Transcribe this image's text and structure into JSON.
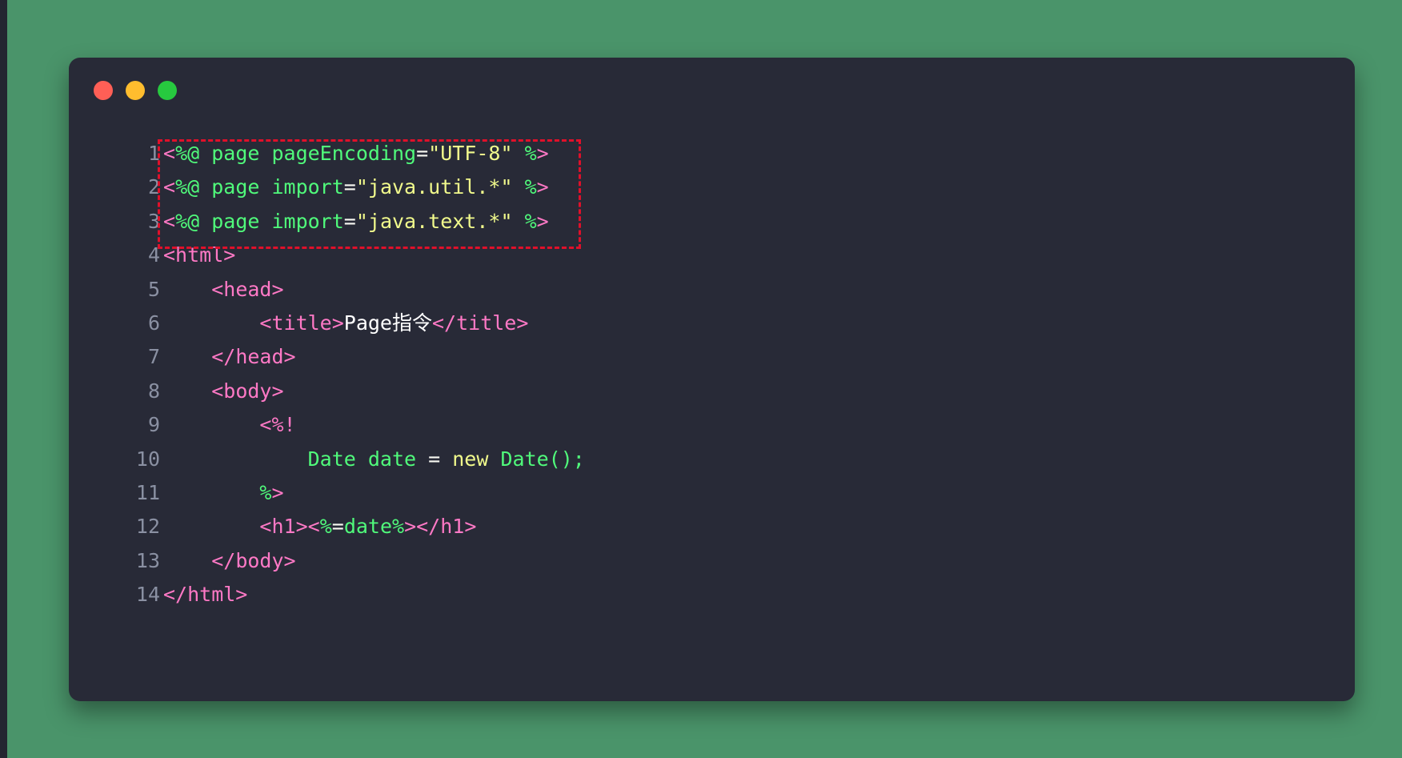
{
  "window": {
    "controls": {
      "close": "close-dot",
      "minimize": "minimize-dot",
      "maximize": "maximize-dot"
    }
  },
  "highlight": {
    "color": "#e0102a",
    "lines": [
      1,
      2,
      3
    ]
  },
  "colors": {
    "background": "#4a946a",
    "editor": "#282a37",
    "tag": "#ff79c6",
    "directive": "#50fa7b",
    "string": "#f1fa8c",
    "plain": "#f8f8f2",
    "line_number": "#8a90a2"
  },
  "code": {
    "lines": [
      {
        "num": "1",
        "tokens": [
          {
            "t": "tag",
            "v": "<"
          },
          {
            "t": "dir",
            "v": "%@ page pageEncoding"
          },
          {
            "t": "pl",
            "v": "="
          },
          {
            "t": "str",
            "v": "\"UTF-8\""
          },
          {
            "t": "pl",
            "v": " "
          },
          {
            "t": "dir",
            "v": "%"
          },
          {
            "t": "tag",
            "v": ">"
          }
        ]
      },
      {
        "num": "2",
        "tokens": [
          {
            "t": "tag",
            "v": "<"
          },
          {
            "t": "dir",
            "v": "%@ page import"
          },
          {
            "t": "pl",
            "v": "="
          },
          {
            "t": "str",
            "v": "\"java.util.*\""
          },
          {
            "t": "pl",
            "v": " "
          },
          {
            "t": "dir",
            "v": "%"
          },
          {
            "t": "tag",
            "v": ">"
          }
        ]
      },
      {
        "num": "3",
        "tokens": [
          {
            "t": "tag",
            "v": "<"
          },
          {
            "t": "dir",
            "v": "%@ page import"
          },
          {
            "t": "pl",
            "v": "="
          },
          {
            "t": "str",
            "v": "\"java.text.*\""
          },
          {
            "t": "pl",
            "v": " "
          },
          {
            "t": "dir",
            "v": "%"
          },
          {
            "t": "tag",
            "v": ">"
          }
        ]
      },
      {
        "num": "4",
        "tokens": [
          {
            "t": "tag",
            "v": "<html>"
          }
        ]
      },
      {
        "num": "5",
        "tokens": [
          {
            "t": "pl",
            "v": "    "
          },
          {
            "t": "tag",
            "v": "<head>"
          }
        ]
      },
      {
        "num": "6",
        "tokens": [
          {
            "t": "pl",
            "v": "        "
          },
          {
            "t": "tag",
            "v": "<title>"
          },
          {
            "t": "txt",
            "v": "Page指令"
          },
          {
            "t": "tag",
            "v": "</title>"
          }
        ]
      },
      {
        "num": "7",
        "tokens": [
          {
            "t": "pl",
            "v": "    "
          },
          {
            "t": "tag",
            "v": "</head>"
          }
        ]
      },
      {
        "num": "8",
        "tokens": [
          {
            "t": "pl",
            "v": "    "
          },
          {
            "t": "tag",
            "v": "<body>"
          }
        ]
      },
      {
        "num": "9",
        "tokens": [
          {
            "t": "pl",
            "v": "        "
          },
          {
            "t": "tag",
            "v": "<%!"
          }
        ]
      },
      {
        "num": "10",
        "tokens": [
          {
            "t": "pl",
            "v": "            "
          },
          {
            "t": "dir",
            "v": "Date date "
          },
          {
            "t": "pl",
            "v": "="
          },
          {
            "t": "str",
            "v": " new "
          },
          {
            "t": "dir",
            "v": "Date();"
          }
        ]
      },
      {
        "num": "11",
        "tokens": [
          {
            "t": "pl",
            "v": "        "
          },
          {
            "t": "dir",
            "v": "%"
          },
          {
            "t": "tag",
            "v": ">"
          }
        ]
      },
      {
        "num": "12",
        "tokens": [
          {
            "t": "pl",
            "v": "        "
          },
          {
            "t": "tag",
            "v": "<h1><"
          },
          {
            "t": "dir",
            "v": "%"
          },
          {
            "t": "pl",
            "v": "="
          },
          {
            "t": "dir",
            "v": "date%"
          },
          {
            "t": "tag",
            "v": "></h1>"
          }
        ]
      },
      {
        "num": "13",
        "tokens": [
          {
            "t": "pl",
            "v": "    "
          },
          {
            "t": "tag",
            "v": "</body>"
          }
        ]
      },
      {
        "num": "14",
        "tokens": [
          {
            "t": "tag",
            "v": "</html>"
          }
        ]
      }
    ]
  }
}
